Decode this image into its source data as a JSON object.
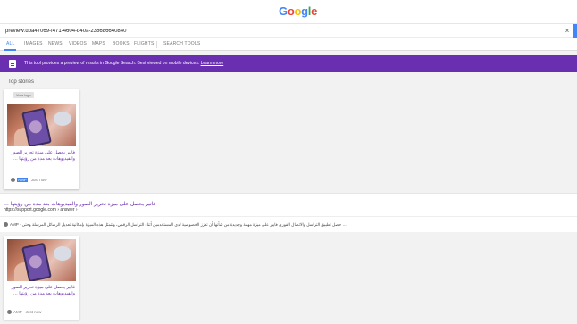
{
  "logo": {
    "text": [
      "G",
      "o",
      "o",
      "g",
      "l",
      "e"
    ],
    "colors": [
      "#4285f4",
      "#ea4335",
      "#fbbc05",
      "#4285f4",
      "#34a853",
      "#ea4335"
    ]
  },
  "search": {
    "value": "preview:dba47069-f471-4604-b40a-238686640840",
    "clear_icon": "×"
  },
  "tabs": [
    "ALL",
    "IMAGES",
    "NEWS",
    "VIDEOS",
    "MAPS",
    "BOOKS",
    "FLIGHTS",
    "SEARCH TOOLS"
  ],
  "banner": {
    "text": "This tool provides a preview of results in Google Search. Best viewed on mobile devices.",
    "link": "Learn more",
    "icon": "phone-icon"
  },
  "top_stories": {
    "title": "Top stories"
  },
  "card1": {
    "badge": "Your logo",
    "headline": "فاتير يحصل على ميزة تحرير الصور والفيديوهات بعد مدة من رؤيتها …",
    "amp": "AMP",
    "time": " · Just now"
  },
  "result": {
    "title": "فاتير يحصل على ميزة تحرير الصور والفيديوهات بعد مدة من رؤيتها …",
    "url": "https://support.google.com › answer ›",
    "snippet": "حصل تطبيق التراسل والاتصال الفوري فايبر على ميزة مهمة وجديدة من شأنها أن تعزز الخصوصية لدى المستخدمين أثناء التراسل الرقمي، وتتمثل هذه الميزة بإمكانية تعديل الرسائل المرسلة وحتى …",
    "amp": "AMP"
  },
  "card2": {
    "headline": "فاتير يحصل على ميزة تحرير الصور والفيديوهات بعد مدة من رؤيتها …",
    "meta": "AMP · Just now"
  }
}
